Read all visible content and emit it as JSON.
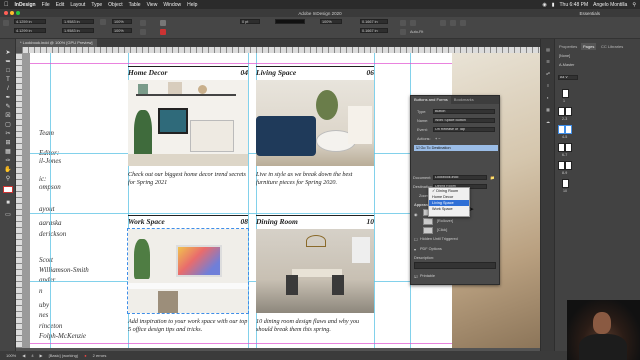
{
  "mac_menu": {
    "app": "InDesign",
    "items": [
      "File",
      "Edit",
      "Layout",
      "Type",
      "Object",
      "Table",
      "View",
      "Window",
      "Help"
    ],
    "clock": "Thu 6:48 PM",
    "user": "Angelo Montilla"
  },
  "window": {
    "title": "Adobe InDesign 2020",
    "workspace": "Essentials"
  },
  "control": {
    "x": "4.1259 in",
    "y": "4.1299 in",
    "w": "1.9583 in",
    "h": "1.9583 in",
    "zoom": "100%",
    "stroke": "0 pt",
    "tint": "100%",
    "ref": "0.1667 in",
    "autofit": "Auto-Fit"
  },
  "document_tab": {
    "label": "* Lookbook.indd @ 100% [GPU Preview]"
  },
  "left_column": {
    "lines": [
      "Team",
      "Editor:",
      "il-Jones",
      "ic:",
      "ompson",
      "ayout",
      "aaraska",
      "derickson",
      "Scott",
      "Williamson-Smith",
      "ander",
      "n",
      "uby",
      "nes",
      "rinceton",
      "Folph-McKenzie"
    ]
  },
  "cards": [
    {
      "title": "Home Decor",
      "num": "04",
      "body": "Check out our biggest home decor trend secrets for Spring 2021"
    },
    {
      "title": "Living Space",
      "num": "06",
      "body": "Live in style as we break down the best furniture pieces for Spring 2020."
    },
    {
      "title": "Work Space",
      "num": "08",
      "body": "Add inspiration to your work space with our top 5 office design tips and tricks."
    },
    {
      "title": "Dining Room",
      "num": "10",
      "body": "10 dining room design flaws and why you should break them this spring."
    }
  ],
  "buttons_panel": {
    "tab_active": "Buttons and Forms",
    "tab_other": "Bookmarks",
    "type_label": "Type:",
    "type_value": "Button",
    "name_label": "Name:",
    "name_value": "Work Space Button",
    "event_label": "Event:",
    "event_value": "On Release or Tap",
    "actions_label": "Actions:",
    "action_item": "Go To Destination",
    "document_label": "Document:",
    "document_value": "Lookbook.indd",
    "destination_label": "Destination:",
    "destination_value": "Dining Room",
    "zoom_label": "Zoom:",
    "appearance_label": "Appearance",
    "state_rollover": "[Rollover]",
    "state_click": "[Click]",
    "hidden_label": "Hidden Until Triggered",
    "pdf_label": "PDF Options",
    "description_label": "Description:",
    "printable_label": "Printable"
  },
  "destination_dropdown": {
    "options": [
      "Dining Room",
      "Home Decor",
      "Living Space",
      "Work Space"
    ],
    "checked": "Dining Room",
    "highlighted": "Living Space"
  },
  "pages_panel": {
    "tabs": [
      "Properties",
      "Pages",
      "CC Libraries"
    ],
    "active_tab": "Pages",
    "none_label": "[None]",
    "master_label": "A-Master",
    "size_label": "A4 V",
    "page_labels": [
      "1",
      "2-3",
      "4-5",
      "6-7",
      "8-9",
      "10"
    ],
    "side_icons": [
      "Pages",
      "Layers",
      "Links",
      "Stroke",
      "Color",
      "Swatches",
      "CC Libraries"
    ]
  },
  "status": {
    "zoom": "100%",
    "page": "4",
    "preflight_profile": "[Basic] (working)",
    "preflight": "2 errors"
  },
  "colors": {
    "guide": "#63c6e6",
    "margin": "#e04fd0",
    "selection": "#9bbde7",
    "highlight": "#2f6fd6"
  }
}
